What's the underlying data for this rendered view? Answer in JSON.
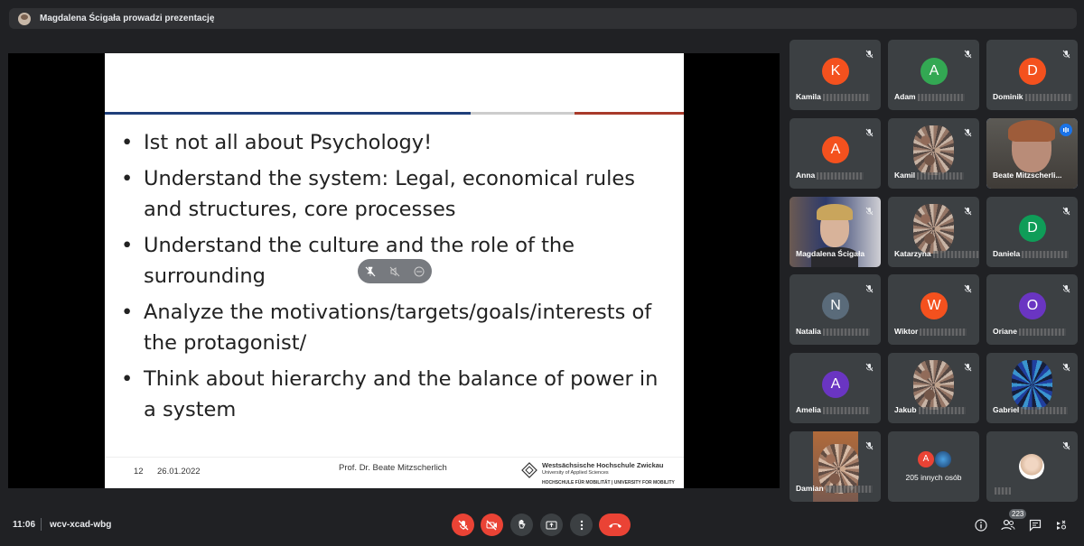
{
  "top_bar": {
    "presenter_text": "Magdalena Ścigała prowadzi prezentację"
  },
  "slide": {
    "bullets": [
      "Ist not all about Psychology!",
      "Understand the system: Legal, economical rules and structures, core processes",
      "Understand the culture and the role of the surrounding",
      "Analyze the motivations/targets/goals/interests of the protagonist/",
      "Think about hierarchy and the balance of power in a system"
    ],
    "bullet_char": "•",
    "footer": {
      "page_number": "12",
      "date": "26.01.2022",
      "presenter": "Prof. Dr. Beate Mitzscherlich",
      "institution": "Westsächsische Hochschule Zwickau",
      "institution_sub": "University of Applied Sciences",
      "institution_tagline": "HOCHSCHULE FÜR MOBILITÄT | UNIVERSITY FOR MOBILITY"
    },
    "colors": {
      "stripe_blue": "#1f3f7a",
      "stripe_gray": "#cccccc",
      "stripe_red": "#a83a2a"
    }
  },
  "participants": [
    {
      "name": "Kamila",
      "initial": "K",
      "color": "#f4511e"
    },
    {
      "name": "Adam",
      "initial": "A",
      "color": "#33a853"
    },
    {
      "name": "Dominik",
      "initial": "D",
      "color": "#f4511e"
    },
    {
      "name": "Anna",
      "initial": "A",
      "color": "#f4511e"
    },
    {
      "name": "Kamil",
      "initial": "",
      "color": ""
    },
    {
      "name": "Beate Mitzscherli...",
      "initial": "",
      "color": ""
    },
    {
      "name": "Magdalena Ścigała",
      "initial": "",
      "color": ""
    },
    {
      "name": "Katarzyna",
      "initial": "",
      "color": ""
    },
    {
      "name": "Daniela",
      "initial": "D",
      "color": "#0f9d58"
    },
    {
      "name": "Natalia",
      "initial": "N",
      "color": "#5a6b7a"
    },
    {
      "name": "Wiktor",
      "initial": "W",
      "color": "#f4511e"
    },
    {
      "name": "Oriane",
      "initial": "O",
      "color": "#6a35c2"
    },
    {
      "name": "Amelia",
      "initial": "A",
      "color": "#6a35c2"
    },
    {
      "name": "Jakub",
      "initial": "",
      "color": ""
    },
    {
      "name": "Gabriel",
      "initial": "",
      "color": ""
    },
    {
      "name": "Damian",
      "initial": "",
      "color": ""
    },
    {
      "name": "205 innych osób",
      "initial": "A",
      "color": "#ea4335"
    },
    {
      "name": "",
      "initial": "",
      "color": ""
    }
  ],
  "bottom_bar": {
    "time": "11:06",
    "meeting_code": "wcv-xcad-wbg",
    "people_count": "223",
    "icons": [
      "mic-off-icon",
      "camera-off-icon",
      "raise-hand-icon",
      "present-screen-icon",
      "more-options-icon",
      "end-call-icon",
      "info-icon",
      "people-icon",
      "chat-icon",
      "activities-icon"
    ]
  }
}
